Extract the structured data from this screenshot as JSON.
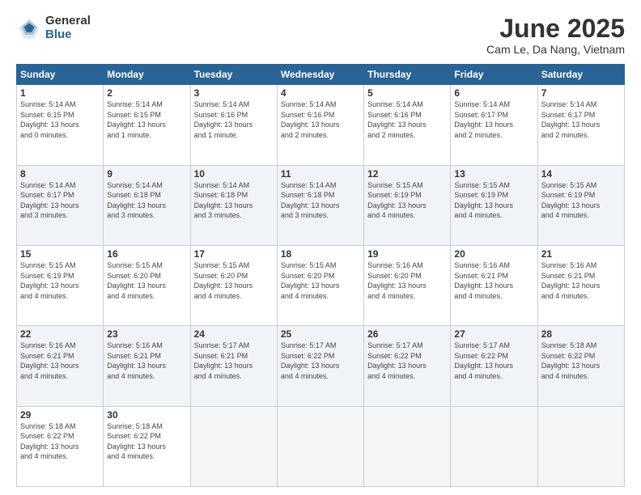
{
  "logo": {
    "general": "General",
    "blue": "Blue"
  },
  "title": "June 2025",
  "location": "Cam Le, Da Nang, Vietnam",
  "days_header": [
    "Sunday",
    "Monday",
    "Tuesday",
    "Wednesday",
    "Thursday",
    "Friday",
    "Saturday"
  ],
  "weeks": [
    [
      {
        "day": "1",
        "info": "Sunrise: 5:14 AM\nSunset: 6:15 PM\nDaylight: 13 hours\nand 0 minutes."
      },
      {
        "day": "2",
        "info": "Sunrise: 5:14 AM\nSunset: 6:15 PM\nDaylight: 13 hours\nand 1 minute."
      },
      {
        "day": "3",
        "info": "Sunrise: 5:14 AM\nSunset: 6:16 PM\nDaylight: 13 hours\nand 1 minute."
      },
      {
        "day": "4",
        "info": "Sunrise: 5:14 AM\nSunset: 6:16 PM\nDaylight: 13 hours\nand 2 minutes."
      },
      {
        "day": "5",
        "info": "Sunrise: 5:14 AM\nSunset: 6:16 PM\nDaylight: 13 hours\nand 2 minutes."
      },
      {
        "day": "6",
        "info": "Sunrise: 5:14 AM\nSunset: 6:17 PM\nDaylight: 13 hours\nand 2 minutes."
      },
      {
        "day": "7",
        "info": "Sunrise: 5:14 AM\nSunset: 6:17 PM\nDaylight: 13 hours\nand 2 minutes."
      }
    ],
    [
      {
        "day": "8",
        "info": "Sunrise: 5:14 AM\nSunset: 6:17 PM\nDaylight: 13 hours\nand 3 minutes."
      },
      {
        "day": "9",
        "info": "Sunrise: 5:14 AM\nSunset: 6:18 PM\nDaylight: 13 hours\nand 3 minutes."
      },
      {
        "day": "10",
        "info": "Sunrise: 5:14 AM\nSunset: 6:18 PM\nDaylight: 13 hours\nand 3 minutes."
      },
      {
        "day": "11",
        "info": "Sunrise: 5:14 AM\nSunset: 6:18 PM\nDaylight: 13 hours\nand 3 minutes."
      },
      {
        "day": "12",
        "info": "Sunrise: 5:15 AM\nSunset: 6:19 PM\nDaylight: 13 hours\nand 4 minutes."
      },
      {
        "day": "13",
        "info": "Sunrise: 5:15 AM\nSunset: 6:19 PM\nDaylight: 13 hours\nand 4 minutes."
      },
      {
        "day": "14",
        "info": "Sunrise: 5:15 AM\nSunset: 6:19 PM\nDaylight: 13 hours\nand 4 minutes."
      }
    ],
    [
      {
        "day": "15",
        "info": "Sunrise: 5:15 AM\nSunset: 6:19 PM\nDaylight: 13 hours\nand 4 minutes."
      },
      {
        "day": "16",
        "info": "Sunrise: 5:15 AM\nSunset: 6:20 PM\nDaylight: 13 hours\nand 4 minutes."
      },
      {
        "day": "17",
        "info": "Sunrise: 5:15 AM\nSunset: 6:20 PM\nDaylight: 13 hours\nand 4 minutes."
      },
      {
        "day": "18",
        "info": "Sunrise: 5:15 AM\nSunset: 6:20 PM\nDaylight: 13 hours\nand 4 minutes."
      },
      {
        "day": "19",
        "info": "Sunrise: 5:16 AM\nSunset: 6:20 PM\nDaylight: 13 hours\nand 4 minutes."
      },
      {
        "day": "20",
        "info": "Sunrise: 5:16 AM\nSunset: 6:21 PM\nDaylight: 13 hours\nand 4 minutes."
      },
      {
        "day": "21",
        "info": "Sunrise: 5:16 AM\nSunset: 6:21 PM\nDaylight: 13 hours\nand 4 minutes."
      }
    ],
    [
      {
        "day": "22",
        "info": "Sunrise: 5:16 AM\nSunset: 6:21 PM\nDaylight: 13 hours\nand 4 minutes."
      },
      {
        "day": "23",
        "info": "Sunrise: 5:16 AM\nSunset: 6:21 PM\nDaylight: 13 hours\nand 4 minutes."
      },
      {
        "day": "24",
        "info": "Sunrise: 5:17 AM\nSunset: 6:21 PM\nDaylight: 13 hours\nand 4 minutes."
      },
      {
        "day": "25",
        "info": "Sunrise: 5:17 AM\nSunset: 6:22 PM\nDaylight: 13 hours\nand 4 minutes."
      },
      {
        "day": "26",
        "info": "Sunrise: 5:17 AM\nSunset: 6:22 PM\nDaylight: 13 hours\nand 4 minutes."
      },
      {
        "day": "27",
        "info": "Sunrise: 5:17 AM\nSunset: 6:22 PM\nDaylight: 13 hours\nand 4 minutes."
      },
      {
        "day": "28",
        "info": "Sunrise: 5:18 AM\nSunset: 6:22 PM\nDaylight: 13 hours\nand 4 minutes."
      }
    ],
    [
      {
        "day": "29",
        "info": "Sunrise: 5:18 AM\nSunset: 6:22 PM\nDaylight: 13 hours\nand 4 minutes."
      },
      {
        "day": "30",
        "info": "Sunrise: 5:18 AM\nSunset: 6:22 PM\nDaylight: 13 hours\nand 4 minutes."
      },
      {
        "day": "",
        "info": ""
      },
      {
        "day": "",
        "info": ""
      },
      {
        "day": "",
        "info": ""
      },
      {
        "day": "",
        "info": ""
      },
      {
        "day": "",
        "info": ""
      }
    ]
  ]
}
